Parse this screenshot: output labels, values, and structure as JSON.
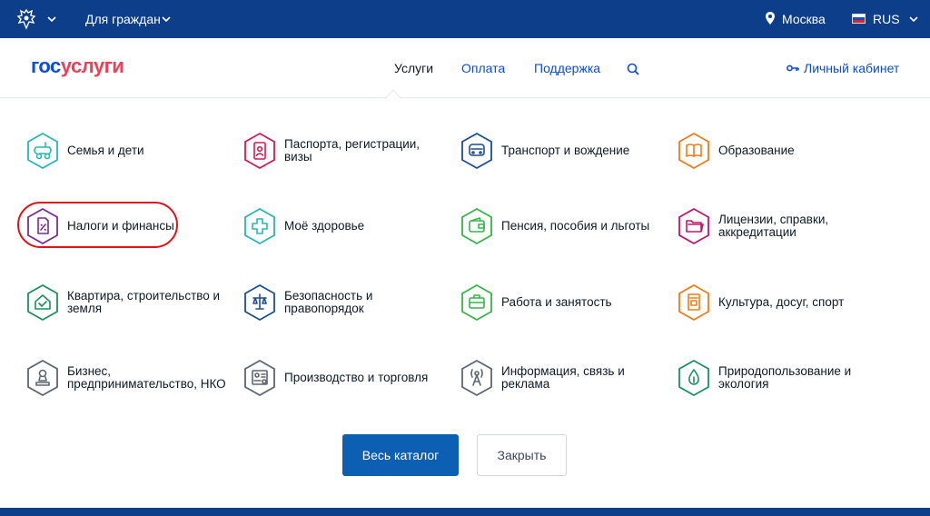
{
  "topbar": {
    "audience_label": "Для граждан",
    "city": "Москва",
    "language": "RUS"
  },
  "header": {
    "logo_part1": "гос",
    "logo_part2": "услуги",
    "nav": [
      "Услуги",
      "Оплата",
      "Поддержка"
    ],
    "cabinet_label": "Личный кабинет"
  },
  "categories": [
    {
      "label": "Семья и дети",
      "color": "#27b8b1"
    },
    {
      "label": "Паспорта, регистрации, визы",
      "color": "#d41b53"
    },
    {
      "label": "Транспорт и вождение",
      "color": "#1d4f8f"
    },
    {
      "label": "Образование",
      "color": "#ef7d1a"
    },
    {
      "label": "Налоги и финансы",
      "color": "#7b2d8e"
    },
    {
      "label": "Моё здоровье",
      "color": "#27b8b1"
    },
    {
      "label": "Пенсия, пособия и льготы",
      "color": "#36b54a"
    },
    {
      "label": "Лицензии, справки, аккредитации",
      "color": "#c0166c"
    },
    {
      "label": "Квартира, строительство и земля",
      "color": "#1e8f5f"
    },
    {
      "label": "Безопасность и правопорядок",
      "color": "#1d4f8f"
    },
    {
      "label": "Работа и занятость",
      "color": "#36b54a"
    },
    {
      "label": "Культура, досуг, спорт",
      "color": "#ef7d1a"
    },
    {
      "label": "Бизнес, предпринимательство, НКО",
      "color": "#5b6770"
    },
    {
      "label": "Производство и торговля",
      "color": "#5b6770"
    },
    {
      "label": "Информация, связь и реклама",
      "color": "#5b6770"
    },
    {
      "label": "Природопользование и экология",
      "color": "#1e8f5f"
    }
  ],
  "buttons": {
    "catalog": "Весь каталог",
    "close": "Закрыть"
  }
}
